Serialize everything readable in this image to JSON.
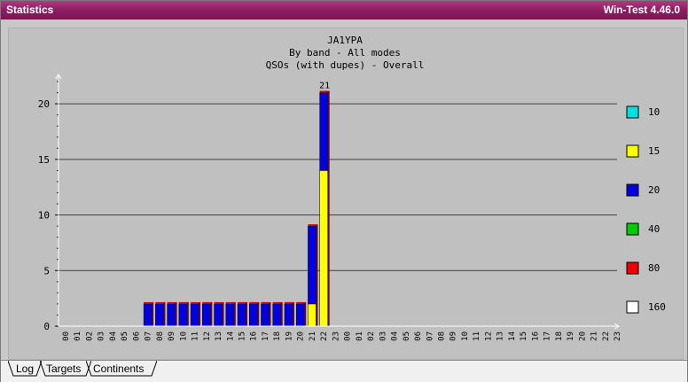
{
  "window": {
    "title": "Statistics",
    "app_version": "Win-Test 4.46.0"
  },
  "tabs": [
    {
      "label": "Log",
      "active": true
    },
    {
      "label": "Targets",
      "active": false
    },
    {
      "label": "Continents",
      "active": false
    }
  ],
  "colors": {
    "titlebar": "#8f1f63",
    "band_10": "#00e0e0",
    "band_15": "#ffff00",
    "band_20": "#0000e0",
    "band_40": "#00cc00",
    "band_80": "#ee0000",
    "band_160": "#ffffff",
    "bar_top": "#cc0000"
  },
  "chart_data": {
    "type": "bar",
    "stacked": true,
    "title": "JA1YPA",
    "subtitle_lines": [
      "By band - All modes",
      "QSOs (with dupes) - Overall"
    ],
    "categories": [
      "00",
      "01",
      "02",
      "03",
      "04",
      "05",
      "06",
      "07",
      "08",
      "09",
      "10",
      "11",
      "12",
      "13",
      "14",
      "15",
      "16",
      "17",
      "18",
      "19",
      "20",
      "21",
      "22",
      "23",
      "00",
      "01",
      "02",
      "03",
      "04",
      "05",
      "06",
      "07",
      "08",
      "09",
      "10",
      "11",
      "12",
      "13",
      "14",
      "15",
      "16",
      "17",
      "18",
      "19",
      "20",
      "21",
      "22",
      "23"
    ],
    "ylim": [
      0,
      22
    ],
    "yticks": [
      0,
      5,
      10,
      15,
      20
    ],
    "grid": true,
    "legend_position": "right",
    "series": [
      {
        "name": "10",
        "color": "#00e0e0",
        "values": [
          0,
          0,
          0,
          0,
          0,
          0,
          0,
          0,
          0,
          0,
          0,
          0,
          0,
          0,
          0,
          0,
          0,
          0,
          0,
          0,
          0,
          0,
          0,
          0,
          0,
          0,
          0,
          0,
          0,
          0,
          0,
          0,
          0,
          0,
          0,
          0,
          0,
          0,
          0,
          0,
          0,
          0,
          0,
          0,
          0,
          0,
          0,
          0
        ]
      },
      {
        "name": "15",
        "color": "#ffff00",
        "values": [
          0,
          0,
          0,
          0,
          0,
          0,
          0,
          0,
          0,
          0,
          0,
          0,
          0,
          0,
          0,
          0,
          0,
          0,
          0,
          0,
          0,
          2,
          14,
          0,
          0,
          0,
          0,
          0,
          0,
          0,
          0,
          0,
          0,
          0,
          0,
          0,
          0,
          0,
          0,
          0,
          0,
          0,
          0,
          0,
          0,
          0,
          0,
          0
        ]
      },
      {
        "name": "20",
        "color": "#0000e0",
        "values": [
          0,
          0,
          0,
          0,
          0,
          0,
          0,
          2,
          2,
          2,
          2,
          2,
          2,
          2,
          2,
          2,
          2,
          2,
          2,
          2,
          2,
          7,
          7,
          0,
          0,
          0,
          0,
          0,
          0,
          0,
          0,
          0,
          0,
          0,
          0,
          0,
          0,
          0,
          0,
          0,
          0,
          0,
          0,
          0,
          0,
          0,
          0,
          0
        ]
      },
      {
        "name": "40",
        "color": "#00cc00",
        "values": [
          0,
          0,
          0,
          0,
          0,
          0,
          0,
          0,
          0,
          0,
          0,
          0,
          0,
          0,
          0,
          0,
          0,
          0,
          0,
          0,
          0,
          0,
          0,
          0,
          0,
          0,
          0,
          0,
          0,
          0,
          0,
          0,
          0,
          0,
          0,
          0,
          0,
          0,
          0,
          0,
          0,
          0,
          0,
          0,
          0,
          0,
          0,
          0
        ]
      },
      {
        "name": "80",
        "color": "#ee0000",
        "values": [
          0,
          0,
          0,
          0,
          0,
          0,
          0,
          0,
          0,
          0,
          0,
          0,
          0,
          0,
          0,
          0,
          0,
          0,
          0,
          0,
          0,
          0,
          0,
          0,
          0,
          0,
          0,
          0,
          0,
          0,
          0,
          0,
          0,
          0,
          0,
          0,
          0,
          0,
          0,
          0,
          0,
          0,
          0,
          0,
          0,
          0,
          0,
          0
        ]
      },
      {
        "name": "160",
        "color": "#ffffff",
        "values": [
          0,
          0,
          0,
          0,
          0,
          0,
          0,
          0,
          0,
          0,
          0,
          0,
          0,
          0,
          0,
          0,
          0,
          0,
          0,
          0,
          0,
          0,
          0,
          0,
          0,
          0,
          0,
          0,
          0,
          0,
          0,
          0,
          0,
          0,
          0,
          0,
          0,
          0,
          0,
          0,
          0,
          0,
          0,
          0,
          0,
          0,
          0,
          0
        ]
      }
    ],
    "max_label": "21"
  }
}
